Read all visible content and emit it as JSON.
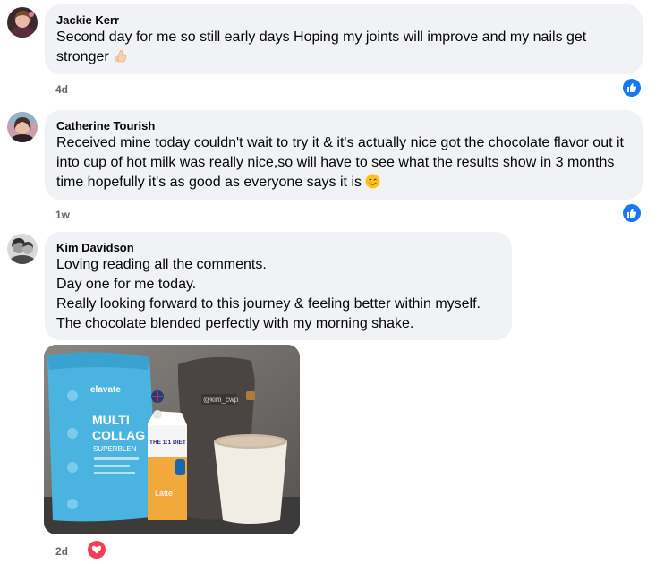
{
  "comments": [
    {
      "author": "Jackie Kerr",
      "text": "Second day for me so still early days Hoping my joints will improve and my nails get stronger",
      "emoji": "thumbs-up-emoji",
      "time": "4d",
      "reaction": "like-icon"
    },
    {
      "author": "Catherine Tourish",
      "text": "Received mine today couldn't wait to try it & it's actually nice got the chocolate flavor out it into cup of hot milk was really nice,so will have to see what the results show in 3 months time hopefully it's as good as everyone says it is",
      "emoji": "smiling-face-emoji",
      "time": "1w",
      "reaction": "like-icon"
    },
    {
      "author": "Kim Davidson",
      "lines": [
        "Loving reading all the comments.",
        "Day one for me today.",
        "Really looking forward to this journey & feeling better within myself.",
        "The chocolate blended perfectly with my morning shake."
      ],
      "time": "2d",
      "reaction": "heart-icon",
      "photo": {
        "bag_brand": "elavate",
        "bag_title_1": "MULTI",
        "bag_title_2": "COLLAG",
        "bag_sub": "SUPERBLEN",
        "carton_brand": "THE 1:1 DIET",
        "carton_flavor": "Latte",
        "watermark": "@kim_cwp"
      }
    }
  ]
}
